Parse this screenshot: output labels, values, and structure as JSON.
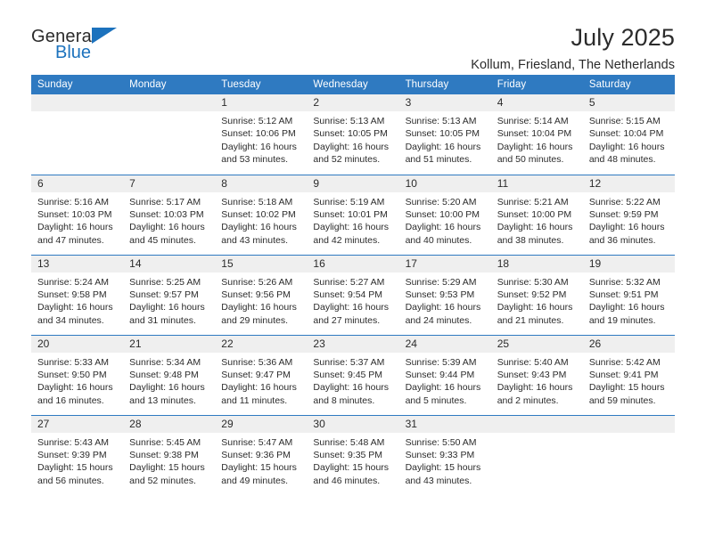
{
  "logo": {
    "word_one": "General",
    "word_two": "Blue",
    "accent_color": "#1c72bd",
    "triangle_icon": "triangle-icon"
  },
  "header": {
    "title": "July 2025",
    "subtitle": "Kollum, Friesland, The Netherlands"
  },
  "theme": {
    "header_bg": "#2f7ac1",
    "daynum_bg": "#efefef",
    "text": "#2b2b2b",
    "page_bg": "#ffffff"
  },
  "calendar": {
    "weekday_headers": [
      "Sunday",
      "Monday",
      "Tuesday",
      "Wednesday",
      "Thursday",
      "Friday",
      "Saturday"
    ],
    "labels": {
      "sunrise": "Sunrise:",
      "sunset": "Sunset:",
      "daylight": "Daylight:"
    },
    "weeks": [
      [
        {
          "day": "",
          "empty": true
        },
        {
          "day": "",
          "empty": true
        },
        {
          "day": "1",
          "sunrise": "Sunrise: 5:12 AM",
          "sunset": "Sunset: 10:06 PM",
          "daylight": "Daylight: 16 hours and 53 minutes."
        },
        {
          "day": "2",
          "sunrise": "Sunrise: 5:13 AM",
          "sunset": "Sunset: 10:05 PM",
          "daylight": "Daylight: 16 hours and 52 minutes."
        },
        {
          "day": "3",
          "sunrise": "Sunrise: 5:13 AM",
          "sunset": "Sunset: 10:05 PM",
          "daylight": "Daylight: 16 hours and 51 minutes."
        },
        {
          "day": "4",
          "sunrise": "Sunrise: 5:14 AM",
          "sunset": "Sunset: 10:04 PM",
          "daylight": "Daylight: 16 hours and 50 minutes."
        },
        {
          "day": "5",
          "sunrise": "Sunrise: 5:15 AM",
          "sunset": "Sunset: 10:04 PM",
          "daylight": "Daylight: 16 hours and 48 minutes."
        }
      ],
      [
        {
          "day": "6",
          "sunrise": "Sunrise: 5:16 AM",
          "sunset": "Sunset: 10:03 PM",
          "daylight": "Daylight: 16 hours and 47 minutes."
        },
        {
          "day": "7",
          "sunrise": "Sunrise: 5:17 AM",
          "sunset": "Sunset: 10:03 PM",
          "daylight": "Daylight: 16 hours and 45 minutes."
        },
        {
          "day": "8",
          "sunrise": "Sunrise: 5:18 AM",
          "sunset": "Sunset: 10:02 PM",
          "daylight": "Daylight: 16 hours and 43 minutes."
        },
        {
          "day": "9",
          "sunrise": "Sunrise: 5:19 AM",
          "sunset": "Sunset: 10:01 PM",
          "daylight": "Daylight: 16 hours and 42 minutes."
        },
        {
          "day": "10",
          "sunrise": "Sunrise: 5:20 AM",
          "sunset": "Sunset: 10:00 PM",
          "daylight": "Daylight: 16 hours and 40 minutes."
        },
        {
          "day": "11",
          "sunrise": "Sunrise: 5:21 AM",
          "sunset": "Sunset: 10:00 PM",
          "daylight": "Daylight: 16 hours and 38 minutes."
        },
        {
          "day": "12",
          "sunrise": "Sunrise: 5:22 AM",
          "sunset": "Sunset: 9:59 PM",
          "daylight": "Daylight: 16 hours and 36 minutes."
        }
      ],
      [
        {
          "day": "13",
          "sunrise": "Sunrise: 5:24 AM",
          "sunset": "Sunset: 9:58 PM",
          "daylight": "Daylight: 16 hours and 34 minutes."
        },
        {
          "day": "14",
          "sunrise": "Sunrise: 5:25 AM",
          "sunset": "Sunset: 9:57 PM",
          "daylight": "Daylight: 16 hours and 31 minutes."
        },
        {
          "day": "15",
          "sunrise": "Sunrise: 5:26 AM",
          "sunset": "Sunset: 9:56 PM",
          "daylight": "Daylight: 16 hours and 29 minutes."
        },
        {
          "day": "16",
          "sunrise": "Sunrise: 5:27 AM",
          "sunset": "Sunset: 9:54 PM",
          "daylight": "Daylight: 16 hours and 27 minutes."
        },
        {
          "day": "17",
          "sunrise": "Sunrise: 5:29 AM",
          "sunset": "Sunset: 9:53 PM",
          "daylight": "Daylight: 16 hours and 24 minutes."
        },
        {
          "day": "18",
          "sunrise": "Sunrise: 5:30 AM",
          "sunset": "Sunset: 9:52 PM",
          "daylight": "Daylight: 16 hours and 21 minutes."
        },
        {
          "day": "19",
          "sunrise": "Sunrise: 5:32 AM",
          "sunset": "Sunset: 9:51 PM",
          "daylight": "Daylight: 16 hours and 19 minutes."
        }
      ],
      [
        {
          "day": "20",
          "sunrise": "Sunrise: 5:33 AM",
          "sunset": "Sunset: 9:50 PM",
          "daylight": "Daylight: 16 hours and 16 minutes."
        },
        {
          "day": "21",
          "sunrise": "Sunrise: 5:34 AM",
          "sunset": "Sunset: 9:48 PM",
          "daylight": "Daylight: 16 hours and 13 minutes."
        },
        {
          "day": "22",
          "sunrise": "Sunrise: 5:36 AM",
          "sunset": "Sunset: 9:47 PM",
          "daylight": "Daylight: 16 hours and 11 minutes."
        },
        {
          "day": "23",
          "sunrise": "Sunrise: 5:37 AM",
          "sunset": "Sunset: 9:45 PM",
          "daylight": "Daylight: 16 hours and 8 minutes."
        },
        {
          "day": "24",
          "sunrise": "Sunrise: 5:39 AM",
          "sunset": "Sunset: 9:44 PM",
          "daylight": "Daylight: 16 hours and 5 minutes."
        },
        {
          "day": "25",
          "sunrise": "Sunrise: 5:40 AM",
          "sunset": "Sunset: 9:43 PM",
          "daylight": "Daylight: 16 hours and 2 minutes."
        },
        {
          "day": "26",
          "sunrise": "Sunrise: 5:42 AM",
          "sunset": "Sunset: 9:41 PM",
          "daylight": "Daylight: 15 hours and 59 minutes."
        }
      ],
      [
        {
          "day": "27",
          "sunrise": "Sunrise: 5:43 AM",
          "sunset": "Sunset: 9:39 PM",
          "daylight": "Daylight: 15 hours and 56 minutes."
        },
        {
          "day": "28",
          "sunrise": "Sunrise: 5:45 AM",
          "sunset": "Sunset: 9:38 PM",
          "daylight": "Daylight: 15 hours and 52 minutes."
        },
        {
          "day": "29",
          "sunrise": "Sunrise: 5:47 AM",
          "sunset": "Sunset: 9:36 PM",
          "daylight": "Daylight: 15 hours and 49 minutes."
        },
        {
          "day": "30",
          "sunrise": "Sunrise: 5:48 AM",
          "sunset": "Sunset: 9:35 PM",
          "daylight": "Daylight: 15 hours and 46 minutes."
        },
        {
          "day": "31",
          "sunrise": "Sunrise: 5:50 AM",
          "sunset": "Sunset: 9:33 PM",
          "daylight": "Daylight: 15 hours and 43 minutes."
        },
        {
          "day": "",
          "empty": true
        },
        {
          "day": "",
          "empty": true
        }
      ]
    ]
  }
}
